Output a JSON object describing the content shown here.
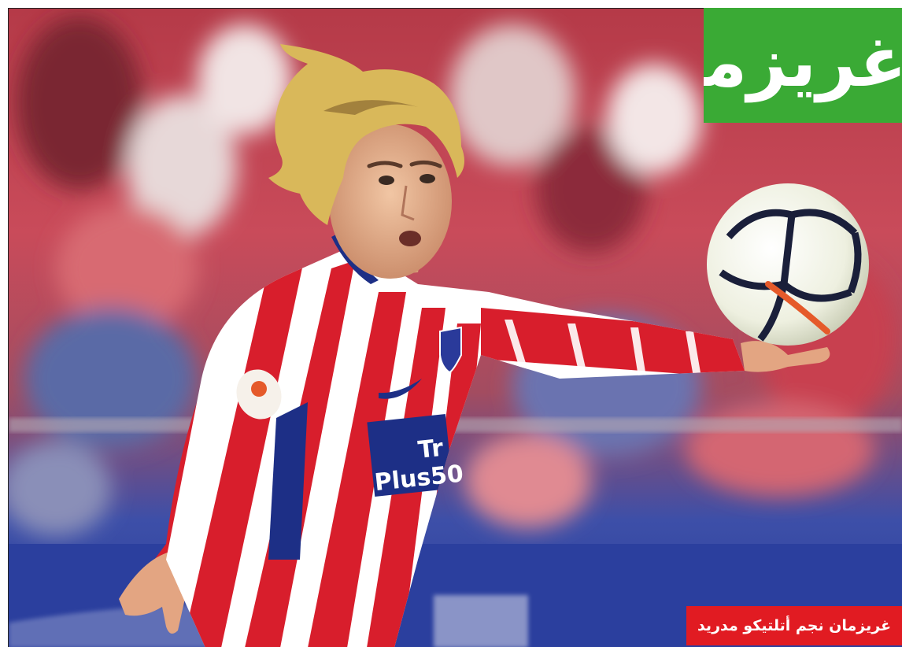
{
  "headline": {
    "text": "غريزمان",
    "background_color": "#3aaa35",
    "text_color": "#ffffff"
  },
  "caption": {
    "text": "غريزمان نجم أتلتيكو مدريد",
    "background_color": "#e11b22",
    "text_color": "#ffffff"
  },
  "photo": {
    "subject": "football-player-photo",
    "sponsor_logo_lines": [
      "Tr",
      "Plus50"
    ],
    "kit_colors": [
      "#d81e2c",
      "#ffffff",
      "#1d2f86"
    ]
  }
}
